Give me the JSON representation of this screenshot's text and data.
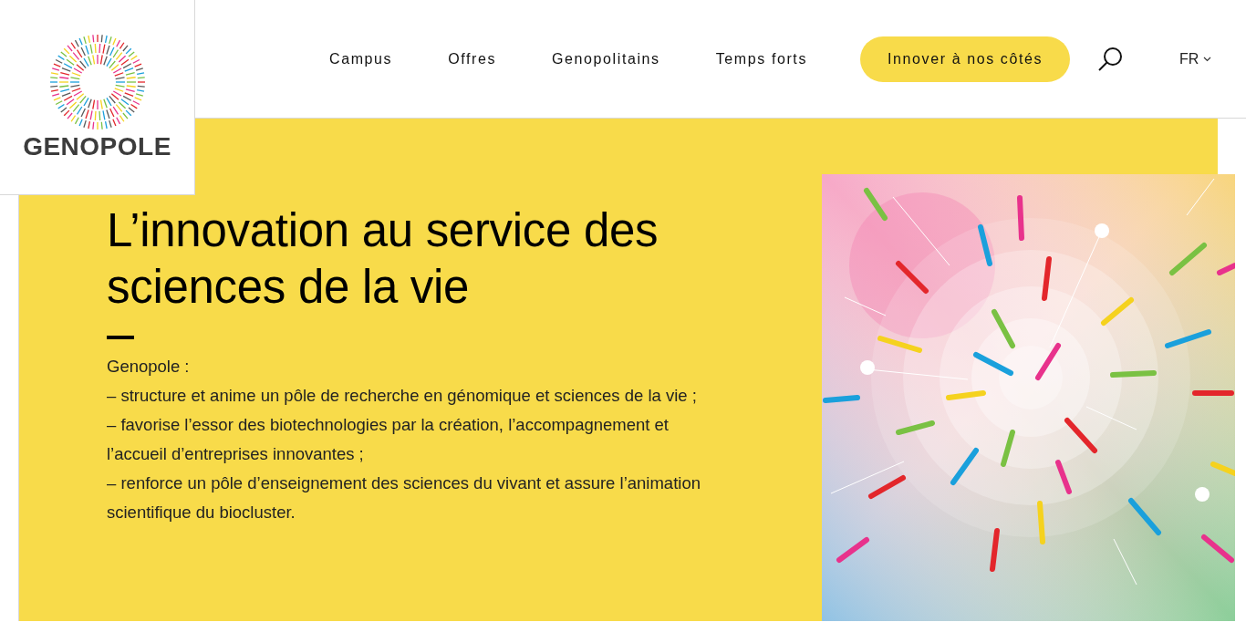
{
  "logo": {
    "text": "GENOPOLE"
  },
  "nav": [
    {
      "label": "Campus"
    },
    {
      "label": "Offres"
    },
    {
      "label": "Genopolitains"
    },
    {
      "label": "Temps forts"
    }
  ],
  "cta": {
    "label": "Innover à nos côtés"
  },
  "language": {
    "label": "FR"
  },
  "hero": {
    "title": "L’innovation au service des sciences de la vie",
    "lines": [
      "Genopole :",
      "– structure et anime un pôle de recherche en génomique et sciences de la vie ;",
      "– favorise l’essor des biotechnologies par la création, l’accompagnement et l’accueil d’entreprises innovantes ;",
      "– renforce un pôle d’enseignement des sciences du vivant et assure l’animation scientifique du biocluster."
    ]
  }
}
